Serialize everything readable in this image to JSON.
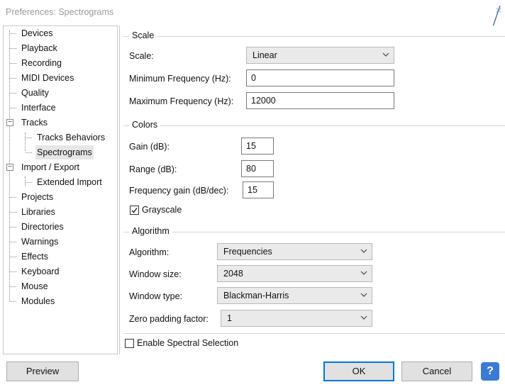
{
  "window": {
    "title": "Preferences: Spectrograms",
    "close_glyph": "×"
  },
  "tree": {
    "items": [
      {
        "label": "Devices"
      },
      {
        "label": "Playback"
      },
      {
        "label": "Recording"
      },
      {
        "label": "MIDI Devices"
      },
      {
        "label": "Quality"
      },
      {
        "label": "Interface"
      },
      {
        "label": "Tracks"
      },
      {
        "label": "Tracks Behaviors"
      },
      {
        "label": "Spectrograms"
      },
      {
        "label": "Import / Export"
      },
      {
        "label": "Extended Import"
      },
      {
        "label": "Projects"
      },
      {
        "label": "Libraries"
      },
      {
        "label": "Directories"
      },
      {
        "label": "Warnings"
      },
      {
        "label": "Effects"
      },
      {
        "label": "Keyboard"
      },
      {
        "label": "Mouse"
      },
      {
        "label": "Modules"
      }
    ],
    "selected": "Spectrograms",
    "expander_glyph": "−"
  },
  "scale": {
    "title": "Scale",
    "scale_label": "Scale:",
    "scale_value": "Linear",
    "min_label": "Minimum Frequency (Hz):",
    "min_value": "0",
    "max_label": "Maximum Frequency (Hz):",
    "max_value": "12000"
  },
  "colors": {
    "title": "Colors",
    "gain_label": "Gain (dB):",
    "gain_value": "15",
    "range_label": "Range (dB):",
    "range_value": "80",
    "freqgain_label": "Frequency gain (dB/dec):",
    "freqgain_value": "15",
    "grayscale_label": "Grayscale",
    "grayscale_checked": true
  },
  "algorithm": {
    "title": "Algorithm",
    "algorithm_label": "Algorithm:",
    "algorithm_value": "Frequencies",
    "window_size_label": "Window size:",
    "window_size_value": "2048",
    "window_type_label": "Window type:",
    "window_type_value": "Blackman-Harris",
    "zero_padding_label": "Zero padding factor:",
    "zero_padding_value": "1"
  },
  "spectral_selection": {
    "label": "Enable Spectral Selection",
    "checked": false
  },
  "buttons": {
    "preview": "Preview",
    "ok": "OK",
    "cancel": "Cancel",
    "help": "?"
  },
  "colors_ui": {
    "accent": "#0078d7",
    "help_bg": "#3a7bd5",
    "annotation_arrow": "#3a68b8"
  }
}
